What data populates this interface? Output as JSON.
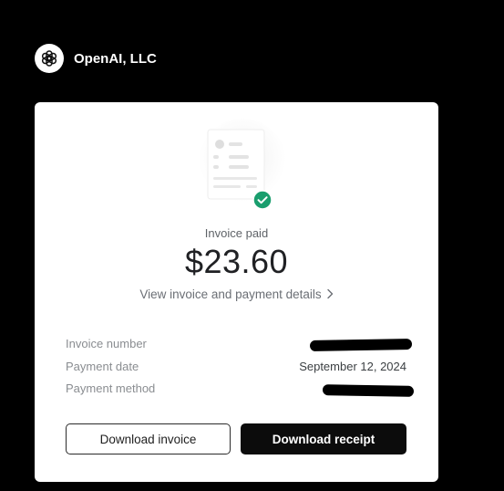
{
  "header": {
    "company_name": "OpenAI, LLC",
    "logo_icon": "openai-logo-icon"
  },
  "invoice": {
    "status": "Invoice paid",
    "amount": "$23.60",
    "details_link": "View invoice and payment details",
    "status_icon": "check-circle-icon",
    "status_color": "#1a9e6e"
  },
  "info": {
    "invoice_number_label": "Invoice number",
    "invoice_number_value": "",
    "payment_date_label": "Payment date",
    "payment_date_value": "September 12, 2024",
    "payment_method_label": "Payment method",
    "payment_method_value": ""
  },
  "actions": {
    "download_invoice": "Download invoice",
    "download_receipt": "Download receipt"
  }
}
